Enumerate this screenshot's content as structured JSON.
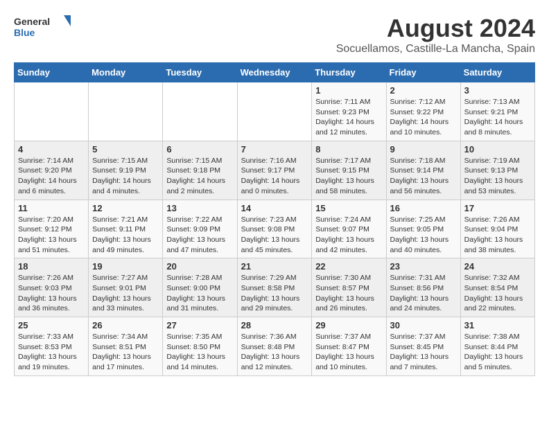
{
  "logo": {
    "text_general": "General",
    "text_blue": "Blue"
  },
  "title": "August 2024",
  "subtitle": "Socuellamos, Castille-La Mancha, Spain",
  "days_of_week": [
    "Sunday",
    "Monday",
    "Tuesday",
    "Wednesday",
    "Thursday",
    "Friday",
    "Saturday"
  ],
  "weeks": [
    [
      {
        "day": "",
        "info": ""
      },
      {
        "day": "",
        "info": ""
      },
      {
        "day": "",
        "info": ""
      },
      {
        "day": "",
        "info": ""
      },
      {
        "day": "1",
        "info": "Sunrise: 7:11 AM\nSunset: 9:23 PM\nDaylight: 14 hours\nand 12 minutes."
      },
      {
        "day": "2",
        "info": "Sunrise: 7:12 AM\nSunset: 9:22 PM\nDaylight: 14 hours\nand 10 minutes."
      },
      {
        "day": "3",
        "info": "Sunrise: 7:13 AM\nSunset: 9:21 PM\nDaylight: 14 hours\nand 8 minutes."
      }
    ],
    [
      {
        "day": "4",
        "info": "Sunrise: 7:14 AM\nSunset: 9:20 PM\nDaylight: 14 hours\nand 6 minutes."
      },
      {
        "day": "5",
        "info": "Sunrise: 7:15 AM\nSunset: 9:19 PM\nDaylight: 14 hours\nand 4 minutes."
      },
      {
        "day": "6",
        "info": "Sunrise: 7:15 AM\nSunset: 9:18 PM\nDaylight: 14 hours\nand 2 minutes."
      },
      {
        "day": "7",
        "info": "Sunrise: 7:16 AM\nSunset: 9:17 PM\nDaylight: 14 hours\nand 0 minutes."
      },
      {
        "day": "8",
        "info": "Sunrise: 7:17 AM\nSunset: 9:15 PM\nDaylight: 13 hours\nand 58 minutes."
      },
      {
        "day": "9",
        "info": "Sunrise: 7:18 AM\nSunset: 9:14 PM\nDaylight: 13 hours\nand 56 minutes."
      },
      {
        "day": "10",
        "info": "Sunrise: 7:19 AM\nSunset: 9:13 PM\nDaylight: 13 hours\nand 53 minutes."
      }
    ],
    [
      {
        "day": "11",
        "info": "Sunrise: 7:20 AM\nSunset: 9:12 PM\nDaylight: 13 hours\nand 51 minutes."
      },
      {
        "day": "12",
        "info": "Sunrise: 7:21 AM\nSunset: 9:11 PM\nDaylight: 13 hours\nand 49 minutes."
      },
      {
        "day": "13",
        "info": "Sunrise: 7:22 AM\nSunset: 9:09 PM\nDaylight: 13 hours\nand 47 minutes."
      },
      {
        "day": "14",
        "info": "Sunrise: 7:23 AM\nSunset: 9:08 PM\nDaylight: 13 hours\nand 45 minutes."
      },
      {
        "day": "15",
        "info": "Sunrise: 7:24 AM\nSunset: 9:07 PM\nDaylight: 13 hours\nand 42 minutes."
      },
      {
        "day": "16",
        "info": "Sunrise: 7:25 AM\nSunset: 9:05 PM\nDaylight: 13 hours\nand 40 minutes."
      },
      {
        "day": "17",
        "info": "Sunrise: 7:26 AM\nSunset: 9:04 PM\nDaylight: 13 hours\nand 38 minutes."
      }
    ],
    [
      {
        "day": "18",
        "info": "Sunrise: 7:26 AM\nSunset: 9:03 PM\nDaylight: 13 hours\nand 36 minutes."
      },
      {
        "day": "19",
        "info": "Sunrise: 7:27 AM\nSunset: 9:01 PM\nDaylight: 13 hours\nand 33 minutes."
      },
      {
        "day": "20",
        "info": "Sunrise: 7:28 AM\nSunset: 9:00 PM\nDaylight: 13 hours\nand 31 minutes."
      },
      {
        "day": "21",
        "info": "Sunrise: 7:29 AM\nSunset: 8:58 PM\nDaylight: 13 hours\nand 29 minutes."
      },
      {
        "day": "22",
        "info": "Sunrise: 7:30 AM\nSunset: 8:57 PM\nDaylight: 13 hours\nand 26 minutes."
      },
      {
        "day": "23",
        "info": "Sunrise: 7:31 AM\nSunset: 8:56 PM\nDaylight: 13 hours\nand 24 minutes."
      },
      {
        "day": "24",
        "info": "Sunrise: 7:32 AM\nSunset: 8:54 PM\nDaylight: 13 hours\nand 22 minutes."
      }
    ],
    [
      {
        "day": "25",
        "info": "Sunrise: 7:33 AM\nSunset: 8:53 PM\nDaylight: 13 hours\nand 19 minutes."
      },
      {
        "day": "26",
        "info": "Sunrise: 7:34 AM\nSunset: 8:51 PM\nDaylight: 13 hours\nand 17 minutes."
      },
      {
        "day": "27",
        "info": "Sunrise: 7:35 AM\nSunset: 8:50 PM\nDaylight: 13 hours\nand 14 minutes."
      },
      {
        "day": "28",
        "info": "Sunrise: 7:36 AM\nSunset: 8:48 PM\nDaylight: 13 hours\nand 12 minutes."
      },
      {
        "day": "29",
        "info": "Sunrise: 7:37 AM\nSunset: 8:47 PM\nDaylight: 13 hours\nand 10 minutes."
      },
      {
        "day": "30",
        "info": "Sunrise: 7:37 AM\nSunset: 8:45 PM\nDaylight: 13 hours\nand 7 minutes."
      },
      {
        "day": "31",
        "info": "Sunrise: 7:38 AM\nSunset: 8:44 PM\nDaylight: 13 hours\nand 5 minutes."
      }
    ]
  ]
}
